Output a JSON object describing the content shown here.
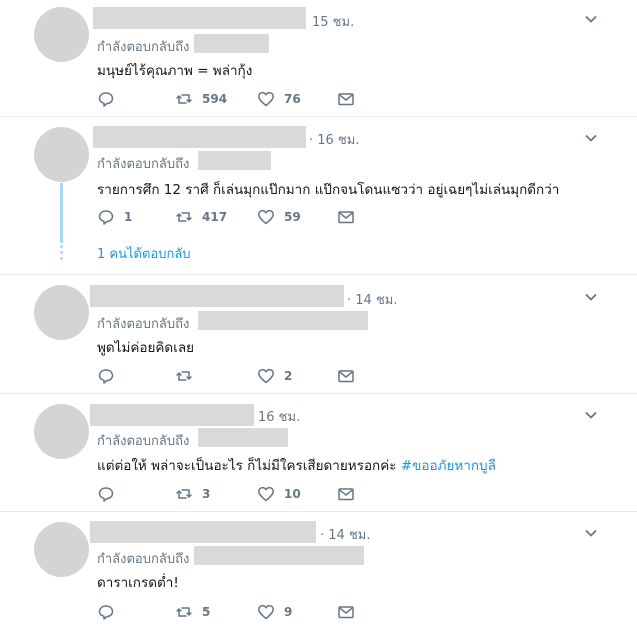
{
  "replying_label": "กำลังตอบกลับถึง",
  "tweets": [
    {
      "time": "15 ชม.",
      "text": "มนุษย์ไร้คุณภาพ = พล่ากุ้ง",
      "replies": "",
      "retweets": "594",
      "likes": "76"
    },
    {
      "time": "· 16 ชม.",
      "text": "รายการศึก 12 ราศี ก็เล่นมุกแป๊กมาก แป๊กจนโดนแซวว่า อยู่เฉยๆไม่เล่นมุกดีกว่า",
      "replies": "1",
      "retweets": "417",
      "likes": "59",
      "show_replies": "1 คนได้ตอบกลับ"
    },
    {
      "time": "· 14 ชม.",
      "text": "พูดไม่ค่อยคิดเลย",
      "replies": "",
      "retweets": "",
      "likes": "2"
    },
    {
      "time": "16 ชม.",
      "text": "แต่ต่อให้ พล่าจะเป็นอะไร ก็ไม่มีใครเสียดายหรอกค่ะ ",
      "hashtag": "#ขออภัยหากบูลี",
      "replies": "",
      "retweets": "3",
      "likes": "10"
    },
    {
      "time": "· 14 ชม.",
      "text": "ดาราเกรดต่ำ!",
      "replies": "",
      "retweets": "5",
      "likes": "9"
    }
  ]
}
